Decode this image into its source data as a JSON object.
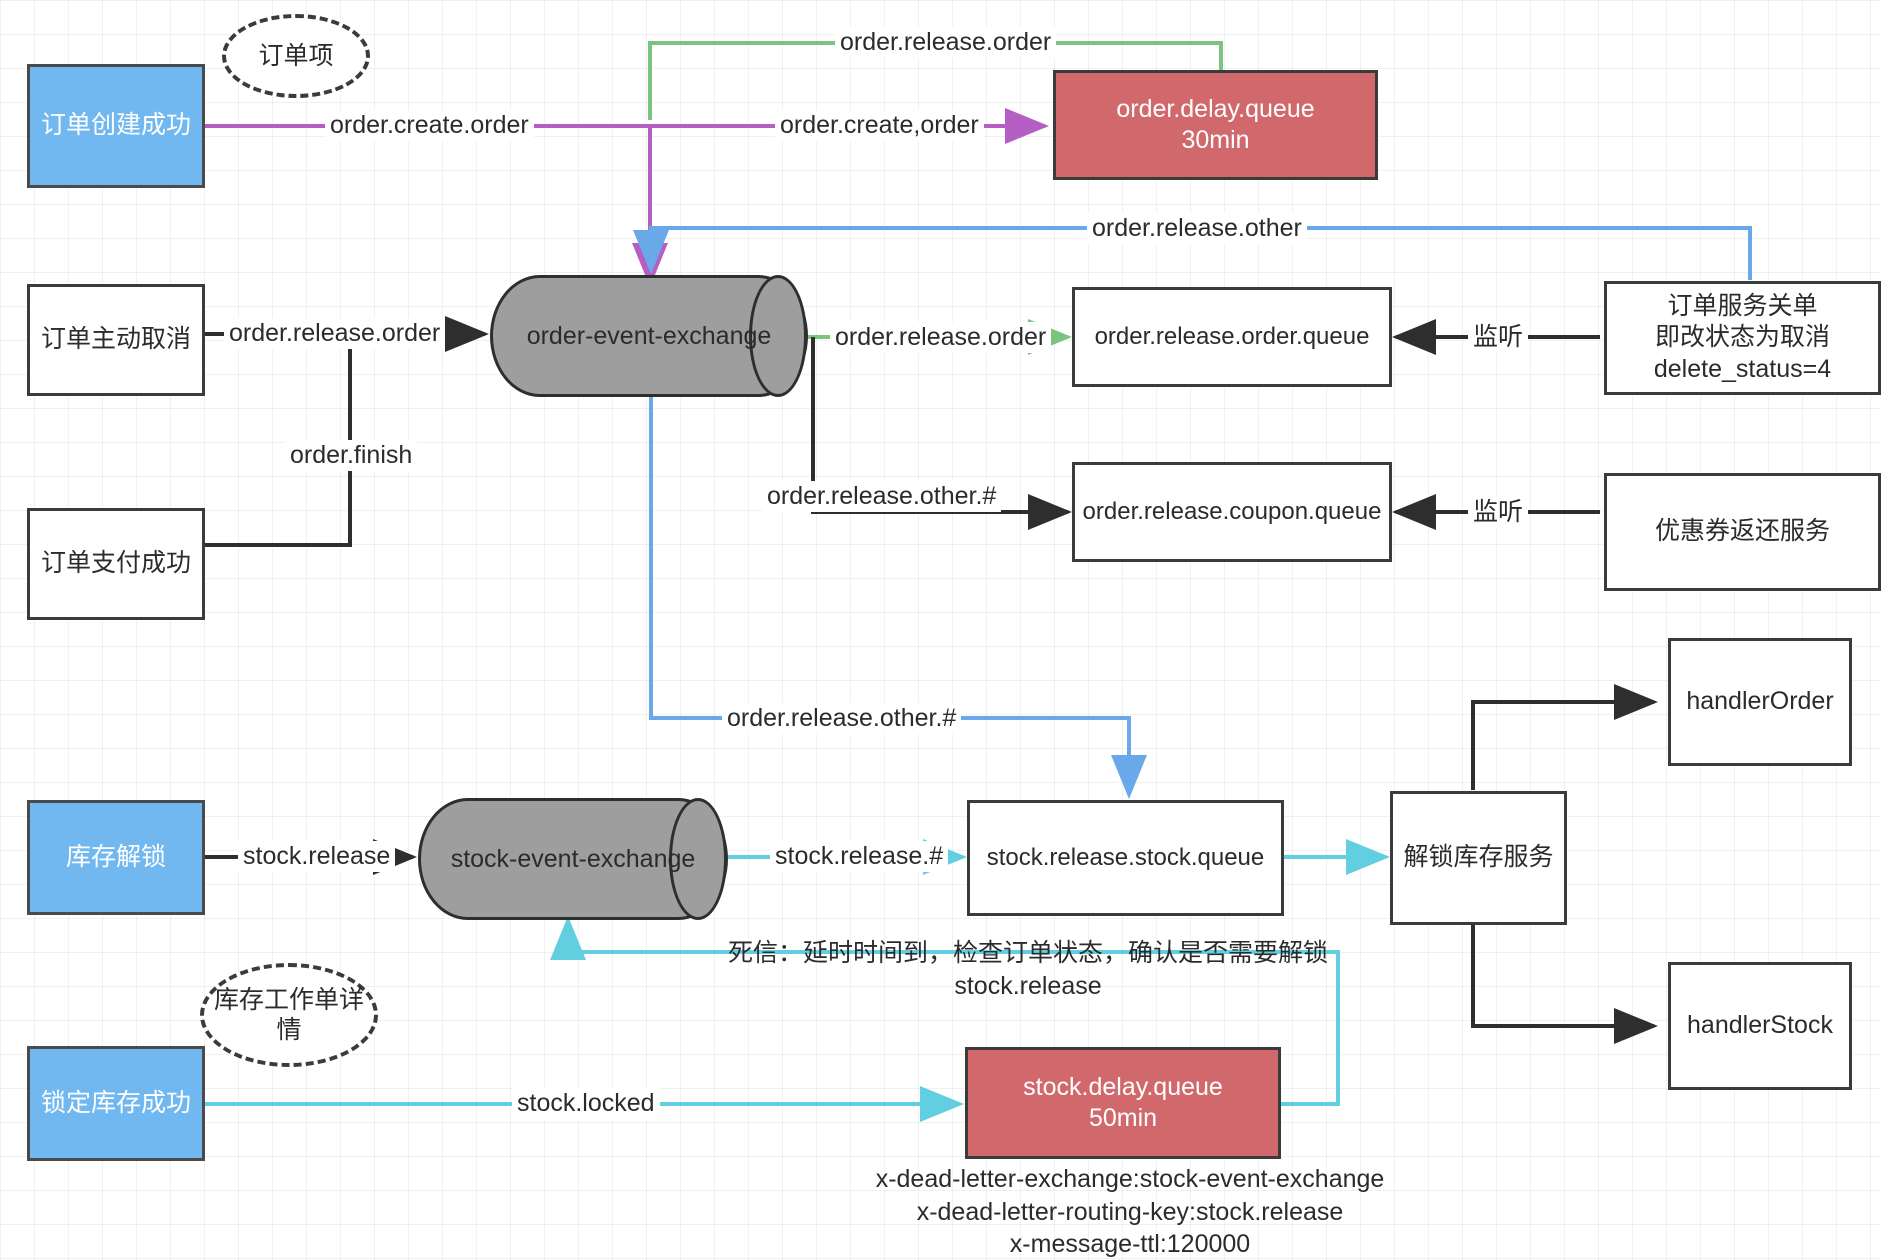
{
  "diagram": {
    "title": "order / stock event exchange message flow",
    "colors": {
      "black": "#3b3b3b",
      "purple": "#b55fc4",
      "green": "#7bc47f",
      "blue": "#6aa9e9",
      "cyan": "#62cfe0",
      "blue_fill": "#72b8f0",
      "red_fill": "#d1696c",
      "grey_fill": "#9e9e9e"
    }
  },
  "nodes": {
    "order_create_success": "订单创建成功",
    "order_item_note": "订单项",
    "order_cancel": "订单主动取消",
    "order_pay_success": "订单支付成功",
    "order_event_exchange": "order-event-exchange",
    "order_delay_queue": "order.delay.queue\n30min",
    "order_release_order_queue": "order.release.order.queue",
    "order_release_coupon_queue": "order.release.coupon.queue",
    "order_close_service": "订单服务关单\n即改状态为取消\ndelete_status=4",
    "coupon_return_service": "优惠券返还服务",
    "stock_unlock": "库存解锁",
    "stock_work_order_note": "库存工作单详情",
    "stock_locked_success": "锁定库存成功",
    "stock_event_exchange": "stock-event-exchange",
    "stock_release_stock_queue": "stock.release.stock.queue",
    "stock_delay_queue": "stock.delay.queue\n50min",
    "unlock_stock_service": "解锁库存服务",
    "handler_order": "handlerOrder",
    "handler_stock": "handlerStock"
  },
  "edge_labels": {
    "order_create_order_left": "order.create.order",
    "order_create_order_right": "order.create,order",
    "order_release_order_top": "order.release.order",
    "order_release_order_left": "order.release.order",
    "order_finish": "order.finish",
    "order_release_other": "order.release.other",
    "order_release_order_to_queue": "order.release.order",
    "order_release_other_hash_1": "order.release.other.#",
    "order_release_other_hash_2": "order.release.other.#",
    "listen_order": "监听",
    "listen_coupon": "监听",
    "stock_release": "stock.release",
    "stock_release_hash": "stock.release.#",
    "stock_locked": "stock.locked",
    "dead_letter_note": "死信：延时时间到，检查订单状态，确认是否需要解锁\nstock.release"
  },
  "notes": {
    "dead_letter_config": "x-dead-letter-exchange:stock-event-exchange\nx-dead-letter-routing-key:stock.release\nx-message-ttl:120000"
  }
}
